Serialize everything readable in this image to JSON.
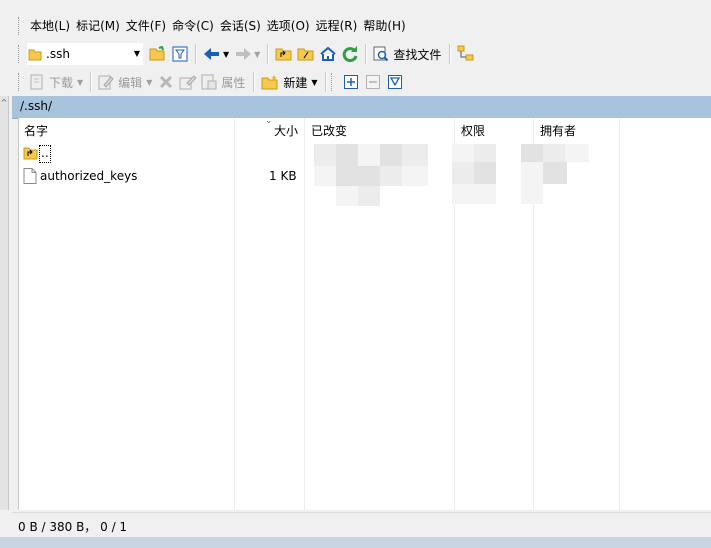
{
  "menu": [
    "本地(L)",
    "标记(M)",
    "文件(F)",
    "命令(C)",
    "会话(S)",
    "选项(O)",
    "远程(R)",
    "帮助(H)"
  ],
  "toolbar1": {
    "path_value": ".ssh",
    "find_label": "查找文件"
  },
  "toolbar2": {
    "download_label": "下载",
    "edit_label": "编辑",
    "properties_label": "属性",
    "new_label": "新建"
  },
  "address": {
    "path": "/.ssh/"
  },
  "columns": {
    "name": "名字",
    "size": "大小",
    "modified": "已改变",
    "rights": "权限",
    "owner": "拥有者"
  },
  "rows": [
    {
      "name": "..",
      "size": "",
      "type": "parent"
    },
    {
      "name": "authorized_keys",
      "size": "1 KB",
      "type": "file"
    }
  ],
  "status": {
    "text": "0 B / 380 B， 0 / 1"
  },
  "colors": {
    "address_bar": "#a8c4dc",
    "folder": "#f6c94c",
    "accent_blue": "#1e5fb4",
    "green": "#2ea043"
  }
}
